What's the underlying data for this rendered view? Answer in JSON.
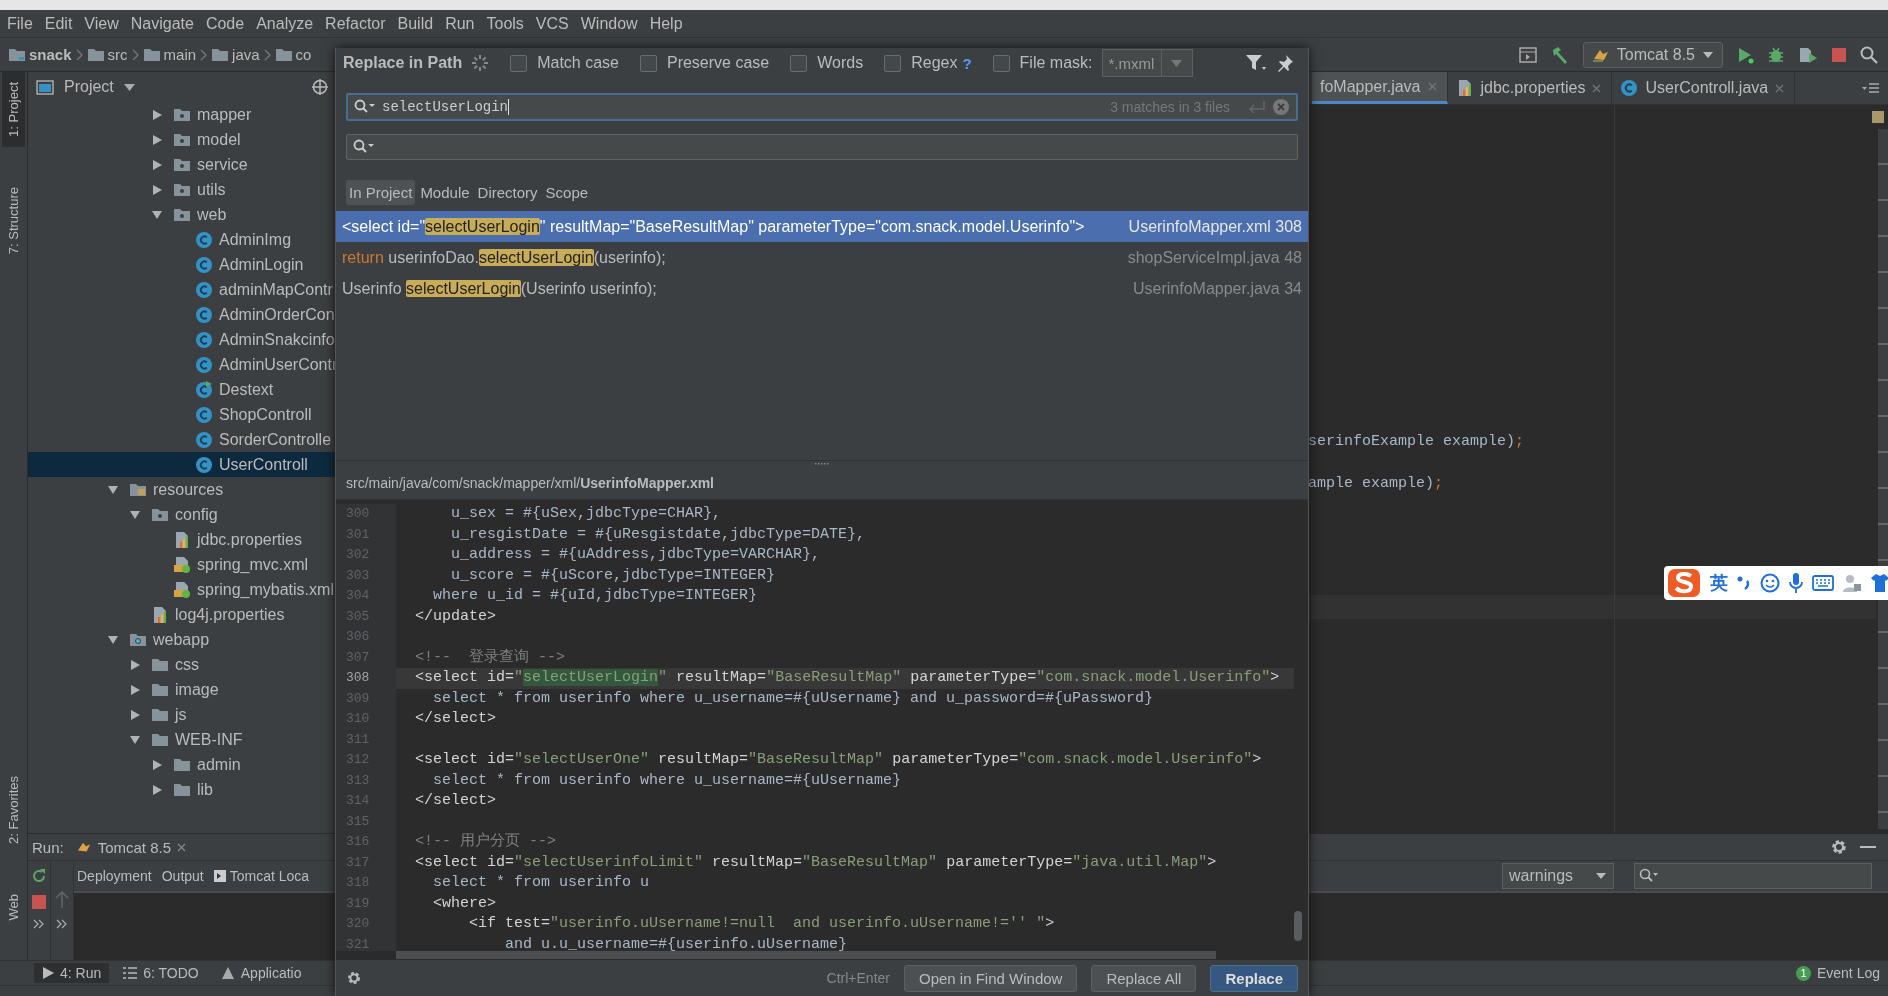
{
  "menu": [
    "File",
    "Edit",
    "View",
    "Navigate",
    "Code",
    "Analyze",
    "Refactor",
    "Build",
    "Run",
    "Tools",
    "VCS",
    "Window",
    "Help"
  ],
  "breadcrumb": [
    {
      "label": "snack",
      "kind": "module"
    },
    {
      "label": "src",
      "kind": "folder"
    },
    {
      "label": "main",
      "kind": "folder"
    },
    {
      "label": "java",
      "kind": "folder"
    },
    {
      "label": "co",
      "kind": "folder"
    }
  ],
  "run_config": "Tomcat 8.5",
  "tool_stripe_top": [
    {
      "label": "1: Project",
      "selected": true
    },
    {
      "label": "7: Structure",
      "selected": false
    }
  ],
  "tool_stripe_bottom": [
    {
      "label": "2: Favorites",
      "selected": false
    },
    {
      "label": "Web",
      "selected": false
    }
  ],
  "project_panel": {
    "title": "Project",
    "tree": [
      {
        "children": [
          {
            "children": [
              {
                "label": "mapper",
                "kind": "package",
                "expanded": false,
                "selected": false
              },
              {
                "label": "model",
                "kind": "package",
                "expanded": false,
                "selected": false
              },
              {
                "label": "service",
                "kind": "package",
                "expanded": false,
                "selected": false
              },
              {
                "label": "utils",
                "kind": "package",
                "expanded": false,
                "selected": false
              },
              {
                "label": "web",
                "kind": "package",
                "expanded": true,
                "selected": false,
                "children": [
                  {
                    "label": "AdminImg",
                    "kind": "class",
                    "selected": false
                  },
                  {
                    "label": "AdminLogin",
                    "kind": "class",
                    "selected": false
                  },
                  {
                    "label": "adminMapContr",
                    "kind": "class",
                    "selected": false
                  },
                  {
                    "label": "AdminOrderCon",
                    "kind": "class",
                    "selected": false
                  },
                  {
                    "label": "AdminSnakcinfo",
                    "kind": "class",
                    "selected": false
                  },
                  {
                    "label": "AdminUserContr",
                    "kind": "class",
                    "selected": false
                  },
                  {
                    "label": "Destext",
                    "kind": "runnable-class",
                    "selected": false
                  },
                  {
                    "label": "ShopControll",
                    "kind": "class",
                    "selected": false
                  },
                  {
                    "label": "SorderControlle",
                    "kind": "class",
                    "selected": false
                  },
                  {
                    "label": "UserControll",
                    "kind": "class",
                    "selected": true
                  }
                ]
              }
            ]
          }
        ]
      },
      {
        "label": "resources",
        "kind": "resources",
        "expanded": true,
        "selected": false,
        "children": [
          {
            "label": "config",
            "kind": "package",
            "expanded": true,
            "selected": false,
            "children": [
              {
                "label": "jdbc.properties",
                "kind": "properties",
                "selected": false
              },
              {
                "label": "spring_mvc.xml",
                "kind": "xml",
                "selected": false
              },
              {
                "label": "spring_mybatis.xml",
                "kind": "xml",
                "selected": false
              }
            ]
          },
          {
            "label": "log4j.properties",
            "kind": "properties",
            "selected": false
          }
        ]
      },
      {
        "label": "webapp",
        "kind": "webapp",
        "expanded": true,
        "selected": false,
        "children": [
          {
            "label": "css",
            "kind": "folder",
            "expanded": false,
            "selected": false
          },
          {
            "label": "image",
            "kind": "folder",
            "expanded": false,
            "selected": false
          },
          {
            "label": "js",
            "kind": "folder",
            "expanded": false,
            "selected": false
          },
          {
            "label": "WEB-INF",
            "kind": "folder",
            "expanded": true,
            "selected": false,
            "children": [
              {
                "label": "admin",
                "kind": "folder",
                "expanded": false,
                "selected": false
              },
              {
                "label": "lib",
                "kind": "folder",
                "expanded": false,
                "selected": false
              }
            ]
          }
        ]
      }
    ]
  },
  "editor": {
    "tabs": [
      {
        "label": "foMapper.java",
        "kind": "plain",
        "selected": true
      },
      {
        "label": "jdbc.properties",
        "kind": "properties",
        "selected": false
      },
      {
        "label": "UserControll.java",
        "kind": "class",
        "selected": false
      }
    ],
    "lines": [
      [
        {
          "kind": "text",
          "text": "serinfoExample example)"
        },
        {
          "kind": "punct",
          "text": ";"
        }
      ],
      [
        {
          "kind": "text",
          "text": "ample example)"
        },
        {
          "kind": "punct",
          "text": ";"
        }
      ]
    ]
  },
  "run_panel": {
    "title": "Run:",
    "tab": "Tomcat 8.5",
    "tabs": [
      {
        "label": "Deployment",
        "kind": "plain",
        "selected": false
      },
      {
        "label": "Output",
        "kind": "plain",
        "selected": false
      },
      {
        "label": "Tomcat Loca",
        "kind": "log",
        "selected": false
      }
    ],
    "filter": "warnings"
  },
  "bottom_tools": [
    {
      "label": "4: Run",
      "kind": "run",
      "selected": true
    },
    {
      "label": "6: TODO",
      "kind": "todo",
      "selected": false
    },
    {
      "label": "Applicatio",
      "kind": "app",
      "selected": false
    }
  ],
  "event_log": {
    "label": "Event Log",
    "count": "1"
  },
  "dialog": {
    "title": "Replace in Path",
    "options": [
      {
        "label": "Match case",
        "checked": false
      },
      {
        "label": "Preserve case",
        "checked": false
      },
      {
        "label": "Words",
        "checked": false
      },
      {
        "label": "Regex",
        "checked": false,
        "help": "?"
      },
      {
        "label": "File mask:",
        "checked": false
      }
    ],
    "file_mask": "*.mxml",
    "search": "selectUserLogin",
    "match_count": "3 matches in 3 files",
    "scopes": [
      {
        "label": "In Project",
        "selected": true
      },
      {
        "label": "Module",
        "selected": false
      },
      {
        "label": "Directory",
        "selected": false
      },
      {
        "label": "Scope",
        "selected": false
      }
    ],
    "results": [
      {
        "segments": [
          {
            "kind": "text",
            "text": "<select id=\""
          },
          {
            "kind": "match",
            "text": "selectUserLogin"
          },
          {
            "kind": "text",
            "text": "\" resultMap=\"BaseResultMap\" parameterType=\"com.snack.model.Userinfo\">"
          }
        ],
        "file": "UserinfoMapper.xml 308",
        "selected": true
      },
      {
        "segments": [
          {
            "kind": "keyword",
            "text": "return"
          },
          {
            "kind": "text",
            "text": " userinfoDao."
          },
          {
            "kind": "match",
            "text": "selectUserLogin"
          },
          {
            "kind": "text",
            "text": "(userinfo);"
          }
        ],
        "file": "shopServiceImpl.java 48",
        "selected": false
      },
      {
        "segments": [
          {
            "kind": "text",
            "text": "Userinfo "
          },
          {
            "kind": "match",
            "text": "selectUserLogin"
          },
          {
            "kind": "text",
            "text": "(Userinfo userinfo);"
          }
        ],
        "file": "UserinfoMapper.java 34",
        "selected": false
      }
    ],
    "preview_path": "src/main/java/com/snack/mapper/xml/**UserinfoMapper.xml**",
    "code": [
      {
        "number": "300",
        "current": false,
        "segments": [
          {
            "kind": "text",
            "text": "      u_sex = #{uSex,jdbcType=CHAR},"
          }
        ]
      },
      {
        "number": "301",
        "current": false,
        "segments": [
          {
            "kind": "text",
            "text": "      u_resgistDate = #{uResgistdate,jdbcType=DATE},"
          }
        ]
      },
      {
        "number": "302",
        "current": false,
        "segments": [
          {
            "kind": "text",
            "text": "      u_address = #{uAddress,jdbcType=VARCHAR},"
          }
        ]
      },
      {
        "number": "303",
        "current": false,
        "segments": [
          {
            "kind": "text",
            "text": "      u_score = #{uScore,jdbcType=INTEGER}"
          }
        ]
      },
      {
        "number": "304",
        "current": false,
        "segments": [
          {
            "kind": "text",
            "text": "    where u_id = #{uId,jdbcType=INTEGER}"
          }
        ]
      },
      {
        "number": "305",
        "current": false,
        "segments": [
          {
            "kind": "tag",
            "text": "  </update>"
          }
        ]
      },
      {
        "number": "306",
        "current": false
      },
      {
        "number": "307",
        "current": false,
        "segments": [
          {
            "kind": "comment",
            "text": "  <!--  登录查询 -->"
          }
        ]
      },
      {
        "number": "308",
        "current": true,
        "segments": [
          {
            "kind": "tag",
            "text": "  <select "
          },
          {
            "kind": "attr",
            "text": "id="
          },
          {
            "kind": "value",
            "text": "\""
          },
          {
            "kind": "match",
            "text": "selectUserLogin"
          },
          {
            "kind": "value",
            "text": "\""
          },
          {
            "kind": "attr",
            "text": " resultMap="
          },
          {
            "kind": "value",
            "text": "\"BaseResultMap\""
          },
          {
            "kind": "attr",
            "text": " parameterType="
          },
          {
            "kind": "value",
            "text": "\"com.snack.model.Userinfo\""
          },
          {
            "kind": "tag",
            "text": ">"
          }
        ]
      },
      {
        "number": "309",
        "current": false,
        "segments": [
          {
            "kind": "text",
            "text": "    select * from userinfo where u_username=#{uUsername} and u_password=#{uPassword}"
          }
        ]
      },
      {
        "number": "310",
        "current": false,
        "segments": [
          {
            "kind": "tag",
            "text": "  </select>"
          }
        ]
      },
      {
        "number": "311",
        "current": false
      },
      {
        "number": "312",
        "current": false,
        "segments": [
          {
            "kind": "tag",
            "text": "  <select "
          },
          {
            "kind": "attr",
            "text": "id="
          },
          {
            "kind": "value",
            "text": "\"selectUserOne\""
          },
          {
            "kind": "attr",
            "text": " resultMap="
          },
          {
            "kind": "value",
            "text": "\"BaseResultMap\""
          },
          {
            "kind": "attr",
            "text": " parameterType="
          },
          {
            "kind": "value",
            "text": "\"com.snack.model.Userinfo\""
          },
          {
            "kind": "tag",
            "text": ">"
          }
        ]
      },
      {
        "number": "313",
        "current": false,
        "segments": [
          {
            "kind": "text",
            "text": "    select * from userinfo where u_username=#{uUsername}"
          }
        ]
      },
      {
        "number": "314",
        "current": false,
        "segments": [
          {
            "kind": "tag",
            "text": "  </select>"
          }
        ]
      },
      {
        "number": "315",
        "current": false
      },
      {
        "number": "316",
        "current": false,
        "segments": [
          {
            "kind": "comment",
            "text": "  <!-- 用户分页 -->"
          }
        ]
      },
      {
        "number": "317",
        "current": false,
        "segments": [
          {
            "kind": "tag",
            "text": "  <select "
          },
          {
            "kind": "attr",
            "text": "id="
          },
          {
            "kind": "value",
            "text": "\"selectUserinfoLimit\""
          },
          {
            "kind": "attr",
            "text": " resultMap="
          },
          {
            "kind": "value",
            "text": "\"BaseResultMap\""
          },
          {
            "kind": "attr",
            "text": " parameterType="
          },
          {
            "kind": "value",
            "text": "\"java.util.Map\""
          },
          {
            "kind": "tag",
            "text": ">"
          }
        ]
      },
      {
        "number": "318",
        "current": false,
        "segments": [
          {
            "kind": "text",
            "text": "    select * from userinfo u"
          }
        ]
      },
      {
        "number": "319",
        "current": false,
        "segments": [
          {
            "kind": "tag",
            "text": "    <where>"
          }
        ]
      },
      {
        "number": "320",
        "current": false,
        "segments": [
          {
            "kind": "tag",
            "text": "        <if "
          },
          {
            "kind": "attr",
            "text": "test="
          },
          {
            "kind": "value",
            "text": "\"userinfo.uUsername!=null  and userinfo.uUsername!='' \""
          },
          {
            "kind": "tag",
            "text": ">"
          }
        ]
      },
      {
        "number": "321",
        "current": false,
        "segments": [
          {
            "kind": "text",
            "text": "            and u.u_username=#{userinfo.uUsername}"
          }
        ]
      }
    ],
    "shortcut": "Ctrl+Enter",
    "buttons": [
      {
        "label": "Open in Find Window",
        "primary": false
      },
      {
        "label": "Replace All",
        "primary": false
      },
      {
        "label": "Replace",
        "primary": true
      }
    ]
  },
  "ime": {
    "mode": "英"
  }
}
